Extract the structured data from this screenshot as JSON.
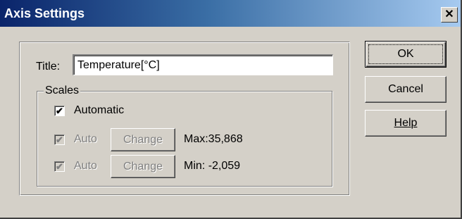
{
  "dialog": {
    "title": "Axis Settings",
    "close_label": "✕"
  },
  "title_field": {
    "label": "Title:",
    "value": "Temperature[°C]"
  },
  "scales": {
    "group_label": "Scales",
    "automatic": {
      "label": "Automatic",
      "checked": true
    },
    "max_row": {
      "auto_label": "Auto",
      "change_label": "Change",
      "value_label": "Max:",
      "value": "35,868"
    },
    "min_row": {
      "auto_label": "Auto",
      "change_label": "Change",
      "value_label": "Min:",
      "value": "-2,059"
    }
  },
  "buttons": {
    "ok": "OK",
    "cancel": "Cancel",
    "help": "Help"
  },
  "check_glyph": "✔"
}
